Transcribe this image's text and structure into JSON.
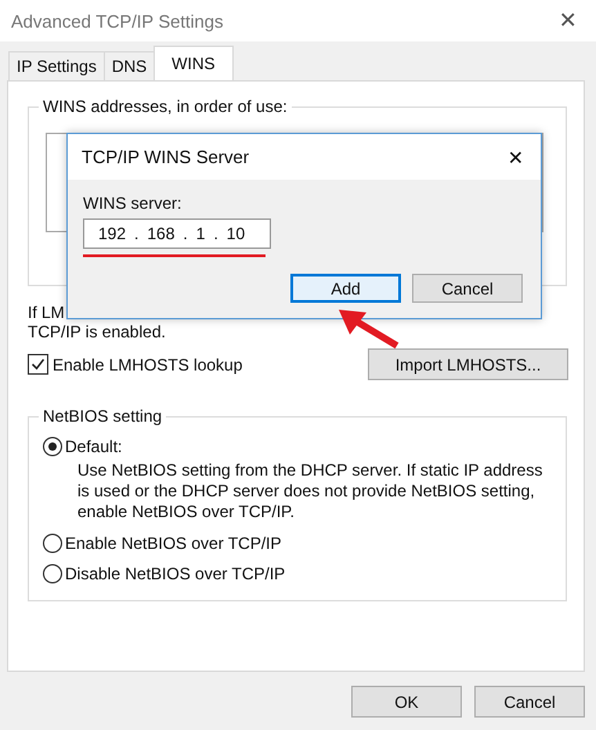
{
  "window": {
    "title": "Advanced TCP/IP Settings",
    "close": "✕"
  },
  "tabs": [
    {
      "label": "IP Settings",
      "selected": false
    },
    {
      "label": "DNS",
      "selected": false
    },
    {
      "label": "WINS",
      "selected": true
    }
  ],
  "wins_group": {
    "title": "WINS addresses, in order of use:"
  },
  "lmhosts_note": [
    "If LM",
    "TCP/IP is enabled."
  ],
  "enable_lmhosts": {
    "label": "Enable LMHOSTS lookup",
    "checked": true
  },
  "import_button": "Import LMHOSTS...",
  "netbios": {
    "title": "NetBIOS setting",
    "options": [
      {
        "label": "Default:",
        "selected": true,
        "description": "Use NetBIOS setting from the DHCP server. If static IP address is used or the DHCP server does not provide NetBIOS setting, enable NetBIOS over TCP/IP."
      },
      {
        "label": "Enable NetBIOS over TCP/IP",
        "selected": false
      },
      {
        "label": "Disable NetBIOS over TCP/IP",
        "selected": false
      }
    ]
  },
  "buttons": [
    "OK",
    "Cancel"
  ],
  "dialog": {
    "title": "TCP/IP WINS Server",
    "close": "✕",
    "field_label": "WINS server:",
    "ip": [
      "192",
      "168",
      "1",
      "10"
    ],
    "ip_separator": ".",
    "buttons": [
      {
        "label": "Add",
        "focused": true
      },
      {
        "label": "Cancel",
        "focused": false
      }
    ]
  }
}
